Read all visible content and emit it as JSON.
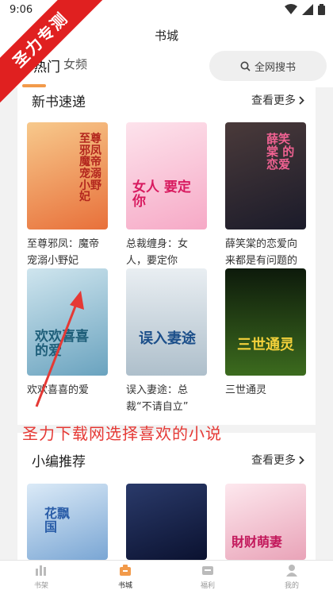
{
  "status": {
    "time": "9:06"
  },
  "header": {
    "title": "书城",
    "tabs": [
      {
        "label": "热门"
      },
      {
        "label": "女频"
      }
    ],
    "search_label": "全网搜书"
  },
  "sections": [
    {
      "title": "新书速递",
      "more": "查看更多",
      "books": [
        {
          "title": "至尊邪凤：魔帝宠溺小野妃",
          "cover_text": "至尊邪凤 魔帝宠溺小野妃",
          "color": "#f0a050"
        },
        {
          "title": "总裁缠身：女人，要定你",
          "cover_text": "女人 要定你",
          "color": "#e86aa0"
        },
        {
          "title": "薛笑棠的恋爱向来都是有问题的",
          "cover_text": "薛笑棠 的恋爱",
          "color": "#2b2b3a"
        },
        {
          "title": "欢欢喜喜的爱",
          "cover_text": "欢欢喜喜的爱",
          "color": "#7ab3c8"
        },
        {
          "title": "误入妻途：总裁“不请自立”",
          "cover_text": "误入妻途",
          "color": "#c9d6df"
        },
        {
          "title": "三世通灵",
          "cover_text": "三世通灵",
          "color": "#1c2a14"
        }
      ]
    },
    {
      "title": "小编推荐",
      "more": "查看更多",
      "books": [
        {
          "cover_text": "花飘国",
          "color": "#8fb8e0"
        },
        {
          "cover_text": "",
          "color": "#1e2a55"
        },
        {
          "cover_text": "財财萌妻",
          "color": "#f4c9d4"
        }
      ]
    }
  ],
  "nav": [
    {
      "label": "书架",
      "icon": "bookshelf-icon"
    },
    {
      "label": "书城",
      "icon": "bookstore-icon",
      "active": true
    },
    {
      "label": "福利",
      "icon": "gift-icon"
    },
    {
      "label": "我的",
      "icon": "profile-icon"
    }
  ],
  "overlay": {
    "caption": "圣力下载网选择喜欢的小说",
    "ribbon": "圣力专测"
  },
  "colors": {
    "accent": "#f29a4a",
    "overlay_red": "#e53935"
  }
}
